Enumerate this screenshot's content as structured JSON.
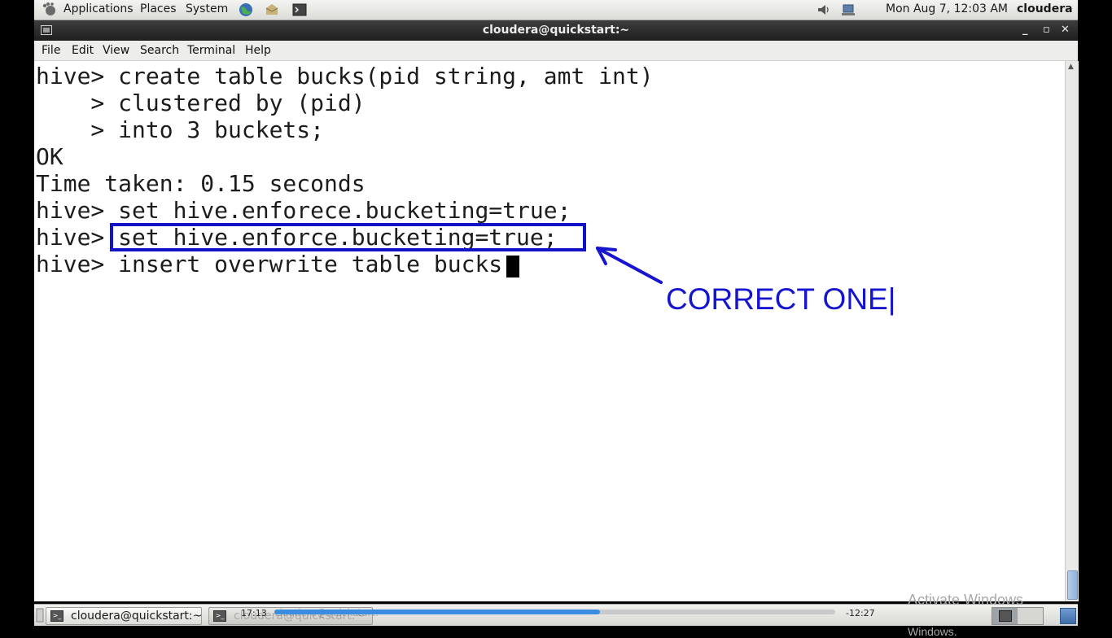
{
  "top_panel": {
    "applications": "Applications",
    "places": "Places",
    "system": "System",
    "clock": "Mon Aug  7, 12:03 AM",
    "user": "cloudera"
  },
  "window": {
    "title": "cloudera@quickstart:~",
    "minimize": "_",
    "maximize": "▫",
    "close": "✕"
  },
  "menubar": {
    "file": "File",
    "edit": "Edit",
    "view": "View",
    "search": "Search",
    "terminal": "Terminal",
    "help": "Help"
  },
  "terminal": {
    "lines": [
      "hive> create table bucks(pid string, amt int)",
      "    > clustered by (pid)",
      "    > into 3 buckets;",
      "OK",
      "Time taken: 0.15 seconds",
      "hive> set hive.enforece.bucketing=true;",
      "hive> set hive.enforce.bucketing=true;",
      "hive> insert overwrite table bucks"
    ]
  },
  "annotation": {
    "label": "CORRECT ONE|",
    "color": "#1515d0"
  },
  "watermark": {
    "line1": "Activate Windows",
    "line2": "Go to Settings to activate Windows."
  },
  "taskbar": {
    "task1": "cloudera@quickstart:~",
    "task2_ghost": "cloudera@quickstart:~"
  },
  "player": {
    "elapsed": "17:13",
    "remaining": "-12:27",
    "progress": 0.58
  },
  "colors": {
    "progress_fill": "#3a8de0",
    "highlight_box": "#1212c8"
  }
}
